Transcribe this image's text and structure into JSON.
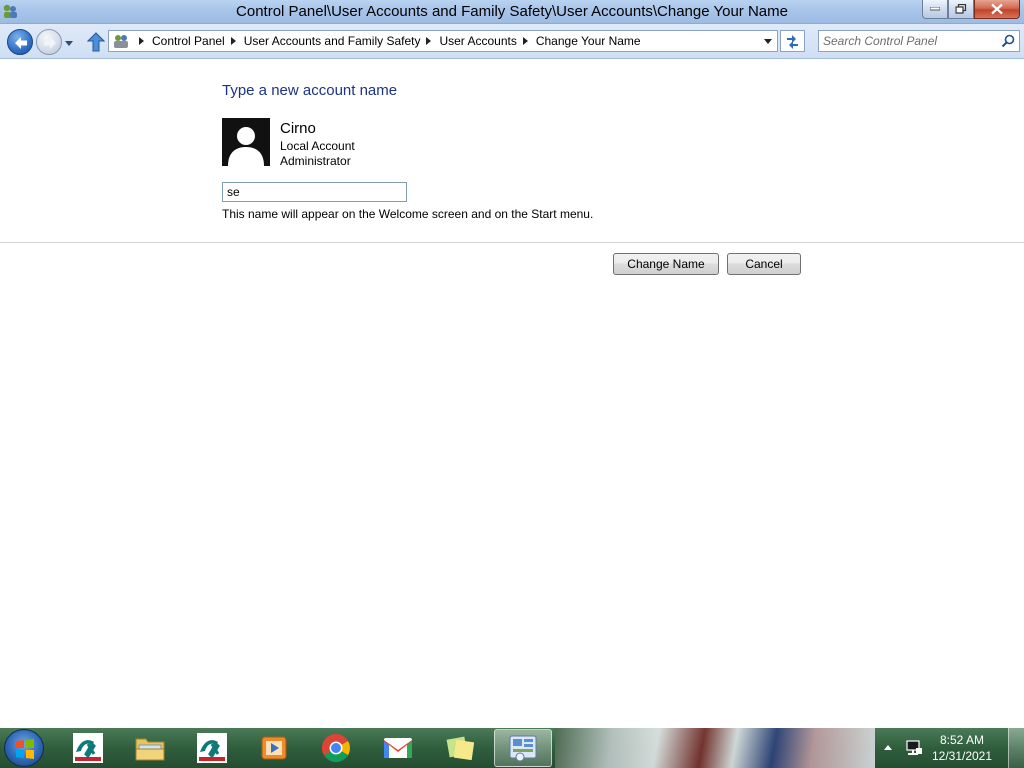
{
  "window": {
    "title": "Control Panel\\User Accounts and Family Safety\\User Accounts\\Change Your Name"
  },
  "address_bar": {
    "breadcrumbs": [
      "Control Panel",
      "User Accounts and Family Safety",
      "User Accounts",
      "Change Your Name"
    ]
  },
  "search": {
    "placeholder": "Search Control Panel"
  },
  "content": {
    "heading": "Type a new account name",
    "user": {
      "name": "Cirno",
      "account_type": "Local Account",
      "role": "Administrator"
    },
    "name_input_value": "se",
    "hint": "This name will appear on the Welcome screen and on the Start menu.",
    "change_button": "Change Name",
    "cancel_button": "Cancel"
  },
  "taskbar": {
    "items": [
      "credit-agricole-app",
      "file-explorer",
      "credit-agricole-app",
      "media-player",
      "chrome",
      "gmail",
      "sticky-notes",
      "control-panel"
    ],
    "active_item": "control-panel",
    "clock_time": "8:52 AM",
    "clock_date": "12/31/2021"
  }
}
